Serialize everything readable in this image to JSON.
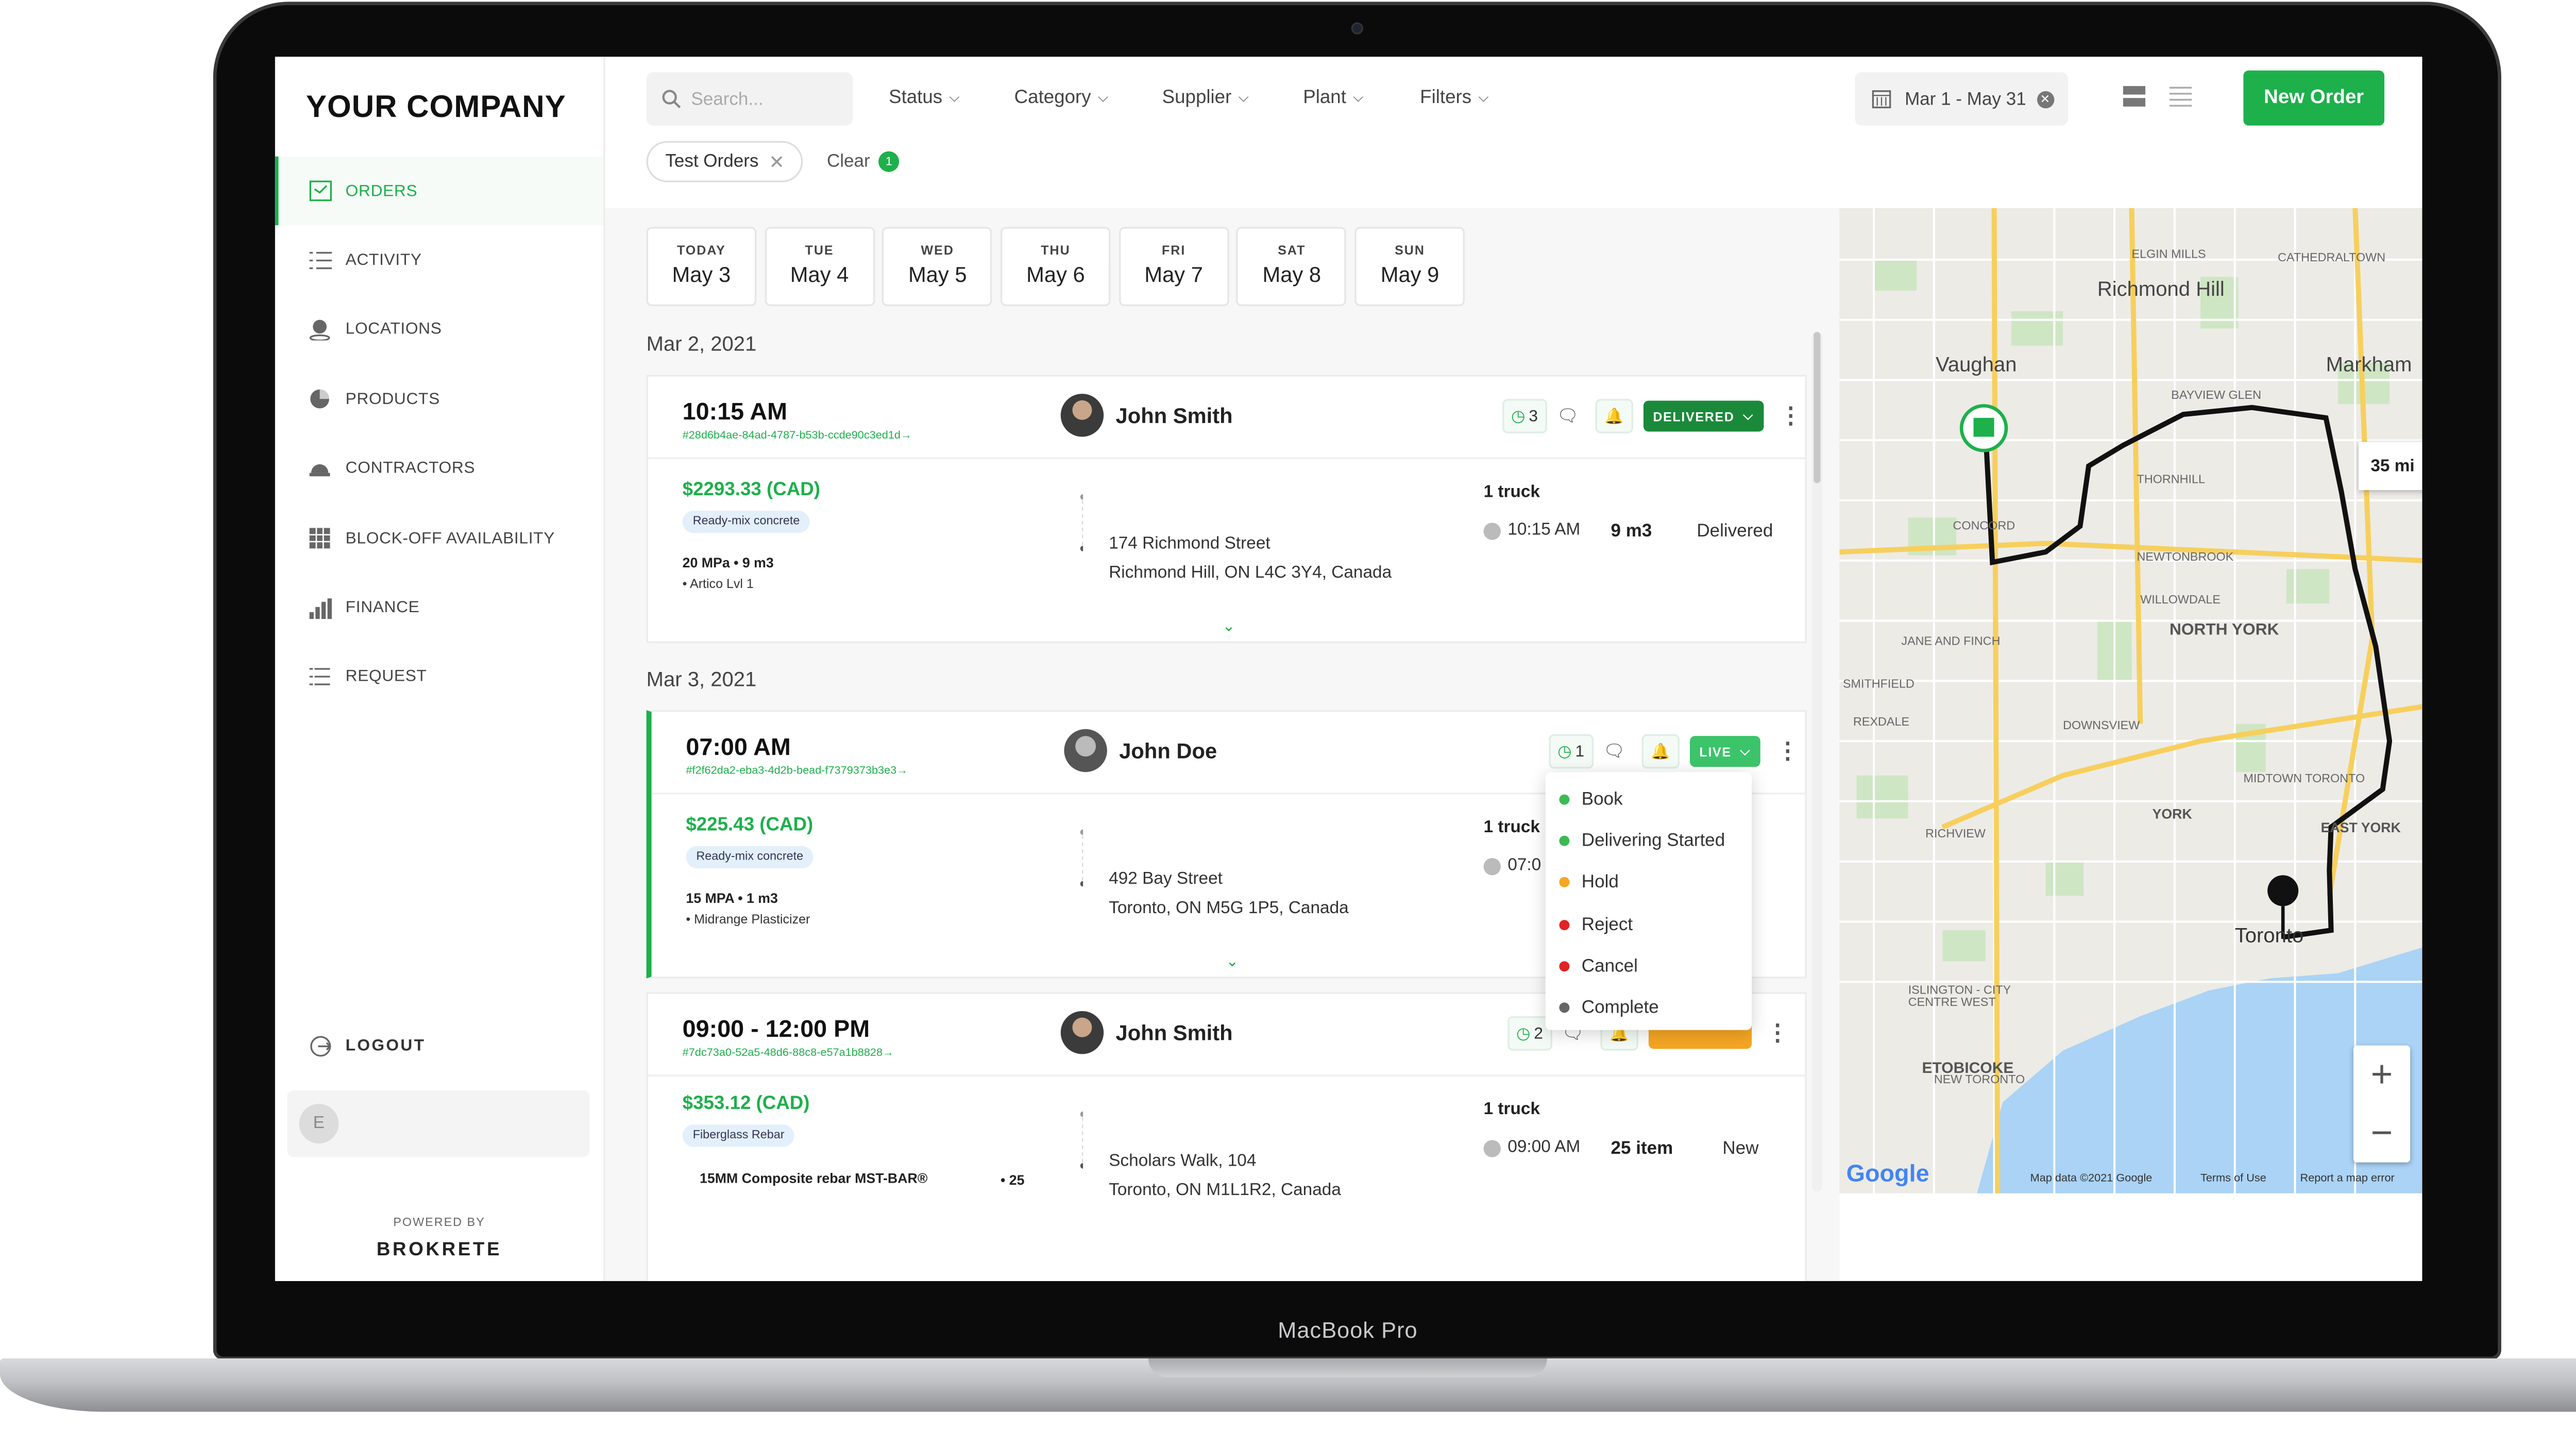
{
  "device": {
    "label": "MacBook Pro"
  },
  "sidebar": {
    "brand": "YOUR COMPANY",
    "items": [
      {
        "label": "ORDERS",
        "icon": "orders-icon",
        "active": true
      },
      {
        "label": "ACTIVITY",
        "icon": "activity-icon"
      },
      {
        "label": "LOCATIONS",
        "icon": "location-pin-icon"
      },
      {
        "label": "PRODUCTS",
        "icon": "pie-icon"
      },
      {
        "label": "CONTRACTORS",
        "icon": "helmet-icon"
      },
      {
        "label": "BLOCK-OFF AVAILABILITY",
        "icon": "calendar-grid-icon"
      },
      {
        "label": "FINANCE",
        "icon": "bar-chart-icon"
      },
      {
        "label": "REQUEST",
        "icon": "list-icon"
      }
    ],
    "logout": "LOGOUT",
    "user_initial": "E",
    "powered_by": "POWERED BY",
    "powered_brand": "BROKRETE"
  },
  "topbar": {
    "search_placeholder": "Search...",
    "filters": [
      "Status",
      "Category",
      "Supplier",
      "Plant",
      "Filters"
    ],
    "date_range": "Mar 1 - May 31",
    "new_order": "New Order",
    "chip": "Test Orders",
    "clear": "Clear",
    "clear_count": "1"
  },
  "days": [
    {
      "name": "TODAY",
      "date": "May 3"
    },
    {
      "name": "TUE",
      "date": "May 4"
    },
    {
      "name": "WED",
      "date": "May 5"
    },
    {
      "name": "THU",
      "date": "May 6"
    },
    {
      "name": "FRI",
      "date": "May 7"
    },
    {
      "name": "SAT",
      "date": "May 8"
    },
    {
      "name": "SUN",
      "date": "May 9"
    }
  ],
  "groups": [
    "Mar 2, 2021",
    "Mar 3, 2021"
  ],
  "orders": [
    {
      "time": "10:15 AM",
      "id": "#28d6b4ae-84ad-4787-b53b-ccde90c3ed1d→",
      "person": "John Smith",
      "count": "3",
      "status_pill": "DELIVERED",
      "price": "$2293.33 (CAD)",
      "tag": "Ready-mix concrete",
      "spec": "20 MPa • 9 m3",
      "spec2": "• Artico Lvl 1",
      "addr1": "174 Richmond Street",
      "addr2": "Richmond Hill, ON L4C 3Y4, Canada",
      "trucks": "1 truck",
      "eta": "10:15 AM",
      "qty": "9 m3",
      "status": "Delivered"
    },
    {
      "time": "07:00 AM",
      "id": "#f2f62da2-eba3-4d2b-bead-f7379373b3e3→",
      "person": "John Doe",
      "count": "1",
      "status_pill": "LIVE",
      "price": "$225.43 (CAD)",
      "tag": "Ready-mix concrete",
      "spec": "15 MPA • 1 m3",
      "spec2": "• Midrange Plasticizer",
      "addr1": "492 Bay Street",
      "addr2": "Toronto, ON M5G 1P5, Canada",
      "trucks": "1 truck",
      "eta": "07:0",
      "qty": "",
      "status": ""
    },
    {
      "time": "09:00 - 12:00 PM",
      "id": "#7dc73a0-52a5-48d6-88c8-e57a1b8828→",
      "person": "John Smith",
      "count": "2",
      "status_pill": "",
      "price": "$353.12 (CAD)",
      "tag": "Fiberglass Rebar",
      "spec": "15MM Composite rebar MST-BAR®",
      "spec_qty": "• 25",
      "addr1": "Scholars Walk, 104",
      "addr2": "Toronto, ON M1L1R2, Canada",
      "trucks": "1 truck",
      "eta": "09:00 AM",
      "qty": "25 item",
      "status": "New"
    }
  ],
  "status_menu": [
    {
      "label": "Book",
      "color": "#3cba54"
    },
    {
      "label": "Delivering Started",
      "color": "#3cba54"
    },
    {
      "label": "Hold",
      "color": "#f5a623"
    },
    {
      "label": "Reject",
      "color": "#e02424"
    },
    {
      "label": "Cancel",
      "color": "#e02424"
    },
    {
      "label": "Complete",
      "color": "#666666"
    }
  ],
  "map": {
    "places": [
      "Richmond Hill",
      "Vaughan",
      "Markham",
      "NORTH YORK",
      "YORK",
      "EAST YORK",
      "Toronto",
      "ETOBICOKE",
      "CONCORD",
      "THORNHILL",
      "NEWTONBROOK",
      "WILLOWDALE",
      "JANE AND FINCH",
      "DOWNSVIEW",
      "MIDTOWN TORONTO",
      "RICHVIEW",
      "REXDALE",
      "ISLINGTON - CITY CENTRE WEST",
      "NEW TORONTO",
      "ELGIN MILLS",
      "CATHEDRALTOWN",
      "BAYVIEW GLEN",
      "SMITHFIELD"
    ],
    "distance": "35 mi",
    "attribution": "Map data ©2021 Google",
    "terms": "Terms of Use",
    "report": "Report a map error",
    "logo": "Google"
  },
  "colors": {
    "accent": "#1db04b",
    "delivered": "#1a8a3a",
    "live": "#3cc46a",
    "pending": "#f5a623"
  }
}
